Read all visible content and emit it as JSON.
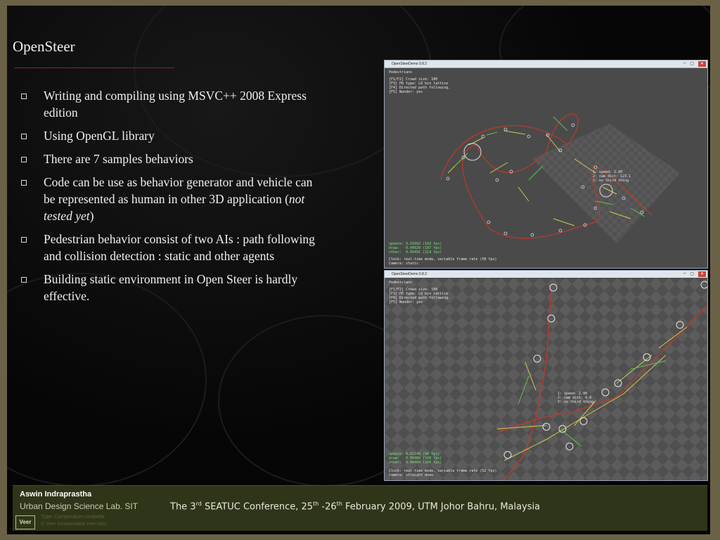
{
  "slide": {
    "title": "OpenSteer",
    "bullets": [
      "Writing and compiling using MSVC++ 2008 Express edition",
      "Using OpenGL library",
      "There are 7 samples behaviors",
      "Code can be use as behavior generator and vehicle can be represented as human in other 3D application (",
      "Pedestrian behavior consist of two AIs : path following and collision detection : static and other agents",
      "Building static environment in Open Steer is hardly effective."
    ],
    "bullet4_italic": "not tested yet",
    "bullet4_close": ")"
  },
  "screenshots": {
    "window_title": "OpenSteerDemo 0.8.2",
    "controls": "─ ▢",
    "close": "✕",
    "top": {
      "heading": "Pedestrians",
      "options": "[F1/F2] Crowd size: 100\n[F3] PD type: LQ bin lattice\n[F4] Directed path following.\n[F5] Wander: yes",
      "annotation": "1: speed: 2.00\n2: cam dist: 123.1\n3: no third thing",
      "stats": "update: 0.01092 (102 fps)\ndraw:   0.00620 (187 fps)\nother:  0.00491 (214 fps)",
      "clock": "Clock: real-time mode, variable frame rate (50 fps)\nCamera: static"
    },
    "bottom": {
      "heading": "Pedestrians",
      "options": "[F1/F2] Crowd size: 100\n[F3] PD type: LQ bin lattice\n[F4] Directed path following.\n[F5] Wander: yes",
      "annotation": "1: speed: 2.00\n2: cam dist: 9.0\n3: no third thing",
      "stats": "update: 0.01148 (98 fps)\ndraw:   0.00466 (160 fps)\nother:  0.00484 (206 fps)",
      "clock": "Clock: real-time mode, variable frame rate (52 fps)\nCamera: straight down"
    }
  },
  "footer": {
    "author": "Aswin Indraprastha",
    "affiliation": "Urban Design Science Lab. SIT",
    "conf_pre": "The 3",
    "conf_sup1": "rd",
    "conf_mid": " SEATUC Conference, 25",
    "conf_sup2": "th",
    "conf_mid2": " -26",
    "conf_sup3": "th",
    "conf_post": "  February 2009, UTM Johor Bahru, Malaysia",
    "logo_text": "Veer",
    "watermark1": "Type: Compendium Umbrella",
    "watermark2": "© Veer Incorporated   veer.com"
  },
  "colors": {
    "background": "#060606",
    "frame": "#6b6146",
    "title_rule": "#8a2a1a",
    "footer": "#2f3518",
    "path_red": "#c0392b",
    "agent_yellow": "#d4c84a",
    "agent_green": "#5fbf4f"
  }
}
